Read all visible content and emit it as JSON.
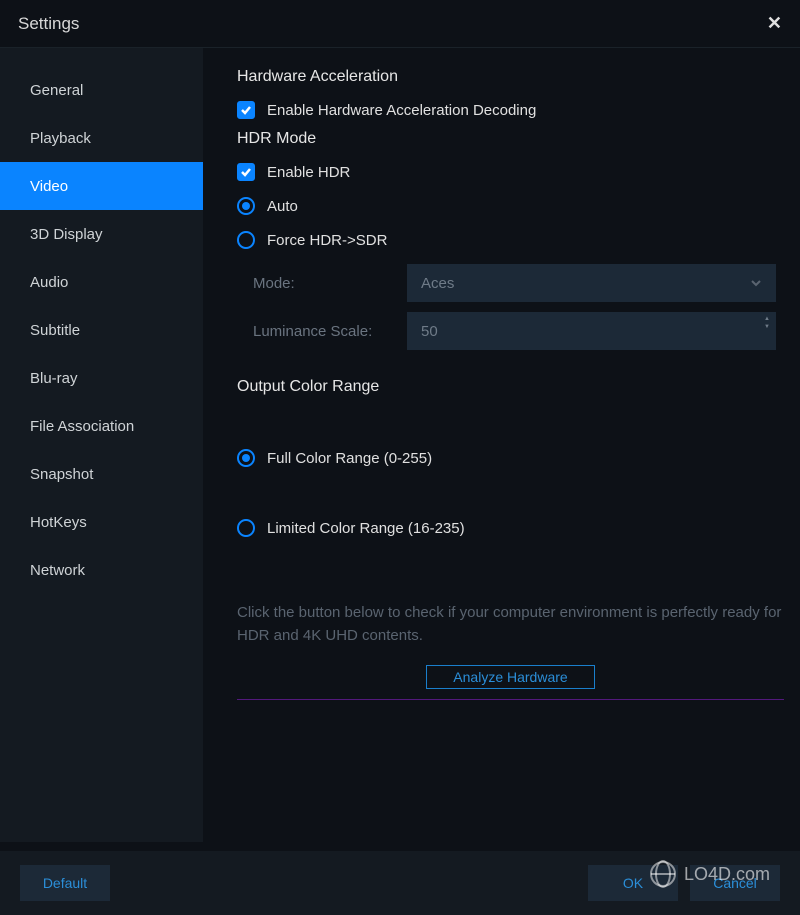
{
  "window": {
    "title": "Settings"
  },
  "sidebar": {
    "items": [
      {
        "label": "General"
      },
      {
        "label": "Playback"
      },
      {
        "label": "Video",
        "active": true
      },
      {
        "label": "3D Display"
      },
      {
        "label": "Audio"
      },
      {
        "label": "Subtitle"
      },
      {
        "label": "Blu-ray"
      },
      {
        "label": "File Association"
      },
      {
        "label": "Snapshot"
      },
      {
        "label": "HotKeys"
      },
      {
        "label": "Network"
      }
    ]
  },
  "content": {
    "hw_accel": {
      "title": "Hardware Acceleration",
      "enable_label": "Enable Hardware Acceleration Decoding",
      "enable_checked": true
    },
    "hdr": {
      "title": "HDR Mode",
      "enable_label": "Enable HDR",
      "enable_checked": true,
      "options": [
        {
          "label": "Auto",
          "selected": true
        },
        {
          "label": "Force HDR->SDR",
          "selected": false
        }
      ],
      "mode_label": "Mode:",
      "mode_value": "Aces",
      "luminance_label": "Luminance Scale:",
      "luminance_value": "50"
    },
    "color_range": {
      "title": "Output Color Range",
      "options": [
        {
          "label": "Full Color Range (0-255)",
          "selected": true
        },
        {
          "label": "Limited Color Range (16-235)",
          "selected": false
        }
      ]
    },
    "analyze": {
      "info": "Click the button below to check if your computer environment is perfectly ready for HDR and 4K UHD contents.",
      "button": "Analyze Hardware"
    }
  },
  "footer": {
    "default": "Default",
    "ok": "OK",
    "cancel": "Cancel"
  },
  "watermark": "LO4D.com"
}
